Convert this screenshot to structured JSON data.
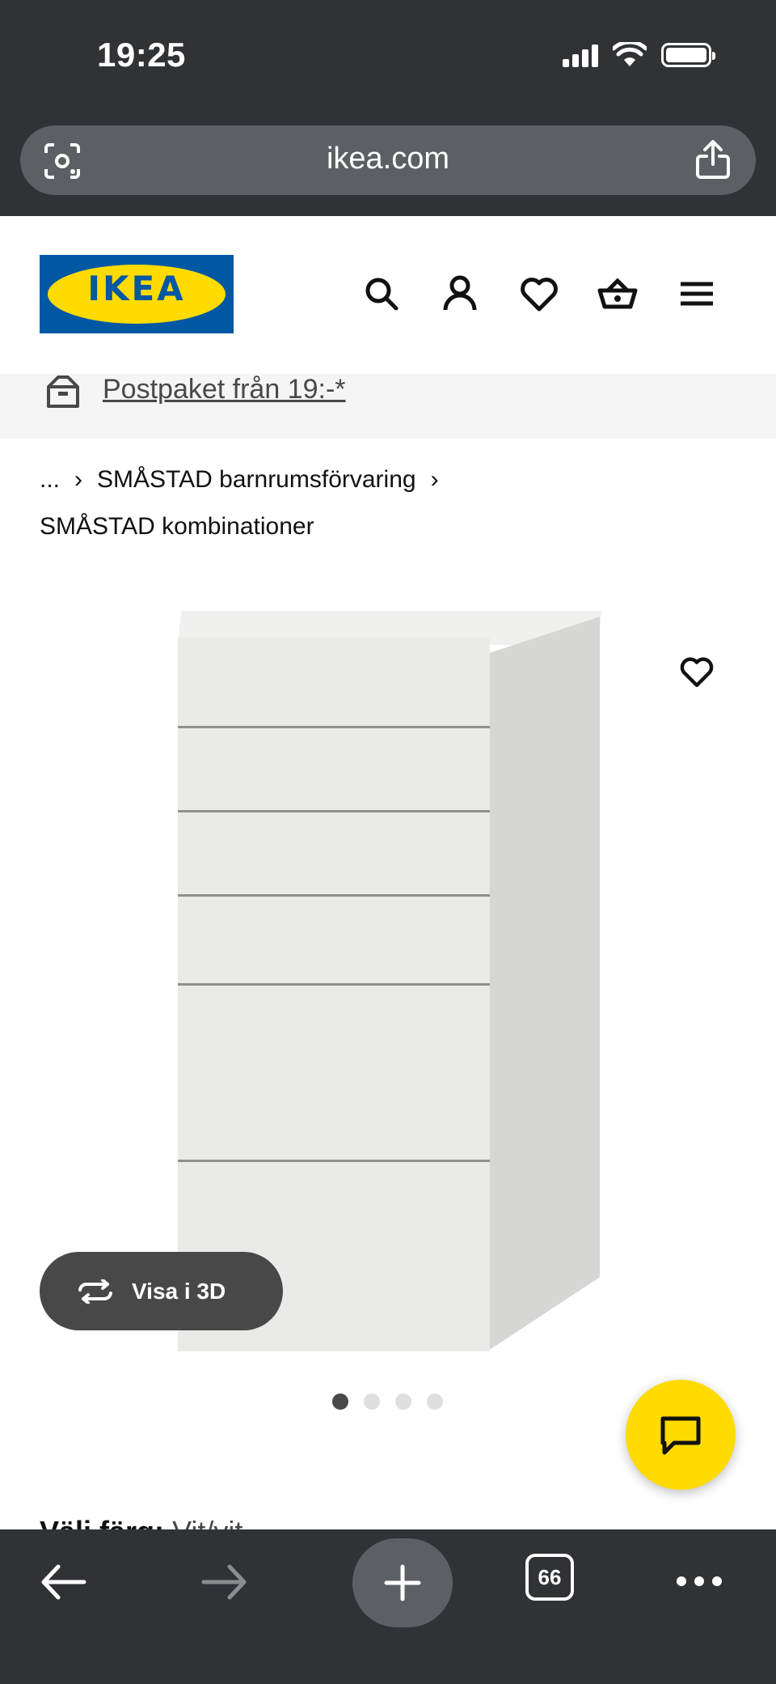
{
  "status_bar": {
    "time": "19:25",
    "icons": [
      "cellular-signal-icon",
      "wifi-icon",
      "battery-icon"
    ]
  },
  "browser": {
    "url": "ikea.com",
    "tab_count": "66"
  },
  "header": {
    "logo_text": "IKEA",
    "icons": [
      "search-icon",
      "account-icon",
      "wishlist-heart-icon",
      "shopping-basket-icon",
      "menu-icon"
    ]
  },
  "promo": {
    "text": "Postpaket från 19:-*"
  },
  "breadcrumb": {
    "ellipsis": "...",
    "category": "SMÅSTAD barnrumsförvaring",
    "current": "SMÅSTAD kombinationer"
  },
  "product": {
    "view3d_label": "Visa i 3D",
    "image_count": 4,
    "active_image": 1
  },
  "color_selector": {
    "label": "Välj färg:",
    "value": "Vit/vit"
  },
  "colors": {
    "ikea_blue": "#0058a3",
    "ikea_yellow": "#ffdb00",
    "chrome_dark": "#303236"
  }
}
